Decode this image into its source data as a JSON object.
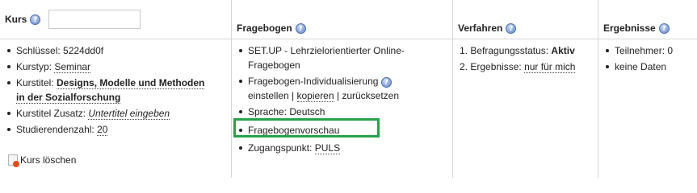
{
  "kurs": {
    "title": "Kurs",
    "help": "?",
    "items": [
      {
        "label": "Schlüssel: ",
        "value": "5224dd0f"
      },
      {
        "label": "Kurstyp: ",
        "value": "Seminar"
      },
      {
        "label": "Kurstitel: ",
        "value_line1": "Designs, Modelle und Methoden",
        "value_line2": "in der Sozialforschung"
      },
      {
        "label": "Kurstitel Zusatz: ",
        "value": "Untertitel eingeben"
      },
      {
        "label": "Studierendenzahl: ",
        "value": "20"
      }
    ],
    "delete_label": "Kurs löschen"
  },
  "fragebogen": {
    "title": "Fragebogen",
    "help": "?",
    "items": {
      "setup_line1": "SET.UP - Lehrzielorientierter Online-",
      "setup_line2": "Fragebogen",
      "indiv_label": "Fragebogen-Individualisierung",
      "indiv_help": "?",
      "einstellen": "einstellen",
      "sep1": " | ",
      "kopieren": "kopieren",
      "sep2": " | ",
      "zuruecksetzen": "zurücksetzen",
      "sprache": "Sprache: Deutsch",
      "vorschau": "Fragebogenvorschau",
      "zugang_label": "Zugangspunkt: ",
      "zugang_value": "PULS"
    }
  },
  "verfahren": {
    "title": "Verfahren",
    "help": "?",
    "status_label": "Befragungsstatus: ",
    "status_value": "Aktiv",
    "ergebnisse_label": "Ergebnisse: ",
    "ergebnisse_value": "nur für mich",
    "num1": "1.",
    "num2": "2."
  },
  "ergebnisse": {
    "title": "Ergebnisse",
    "help": "?",
    "teilnehmer": "Teilnehmer: 0",
    "keine_daten": "keine Daten"
  },
  "colors": {
    "highlight": "#27a24a",
    "border": "#d7d7d7"
  }
}
